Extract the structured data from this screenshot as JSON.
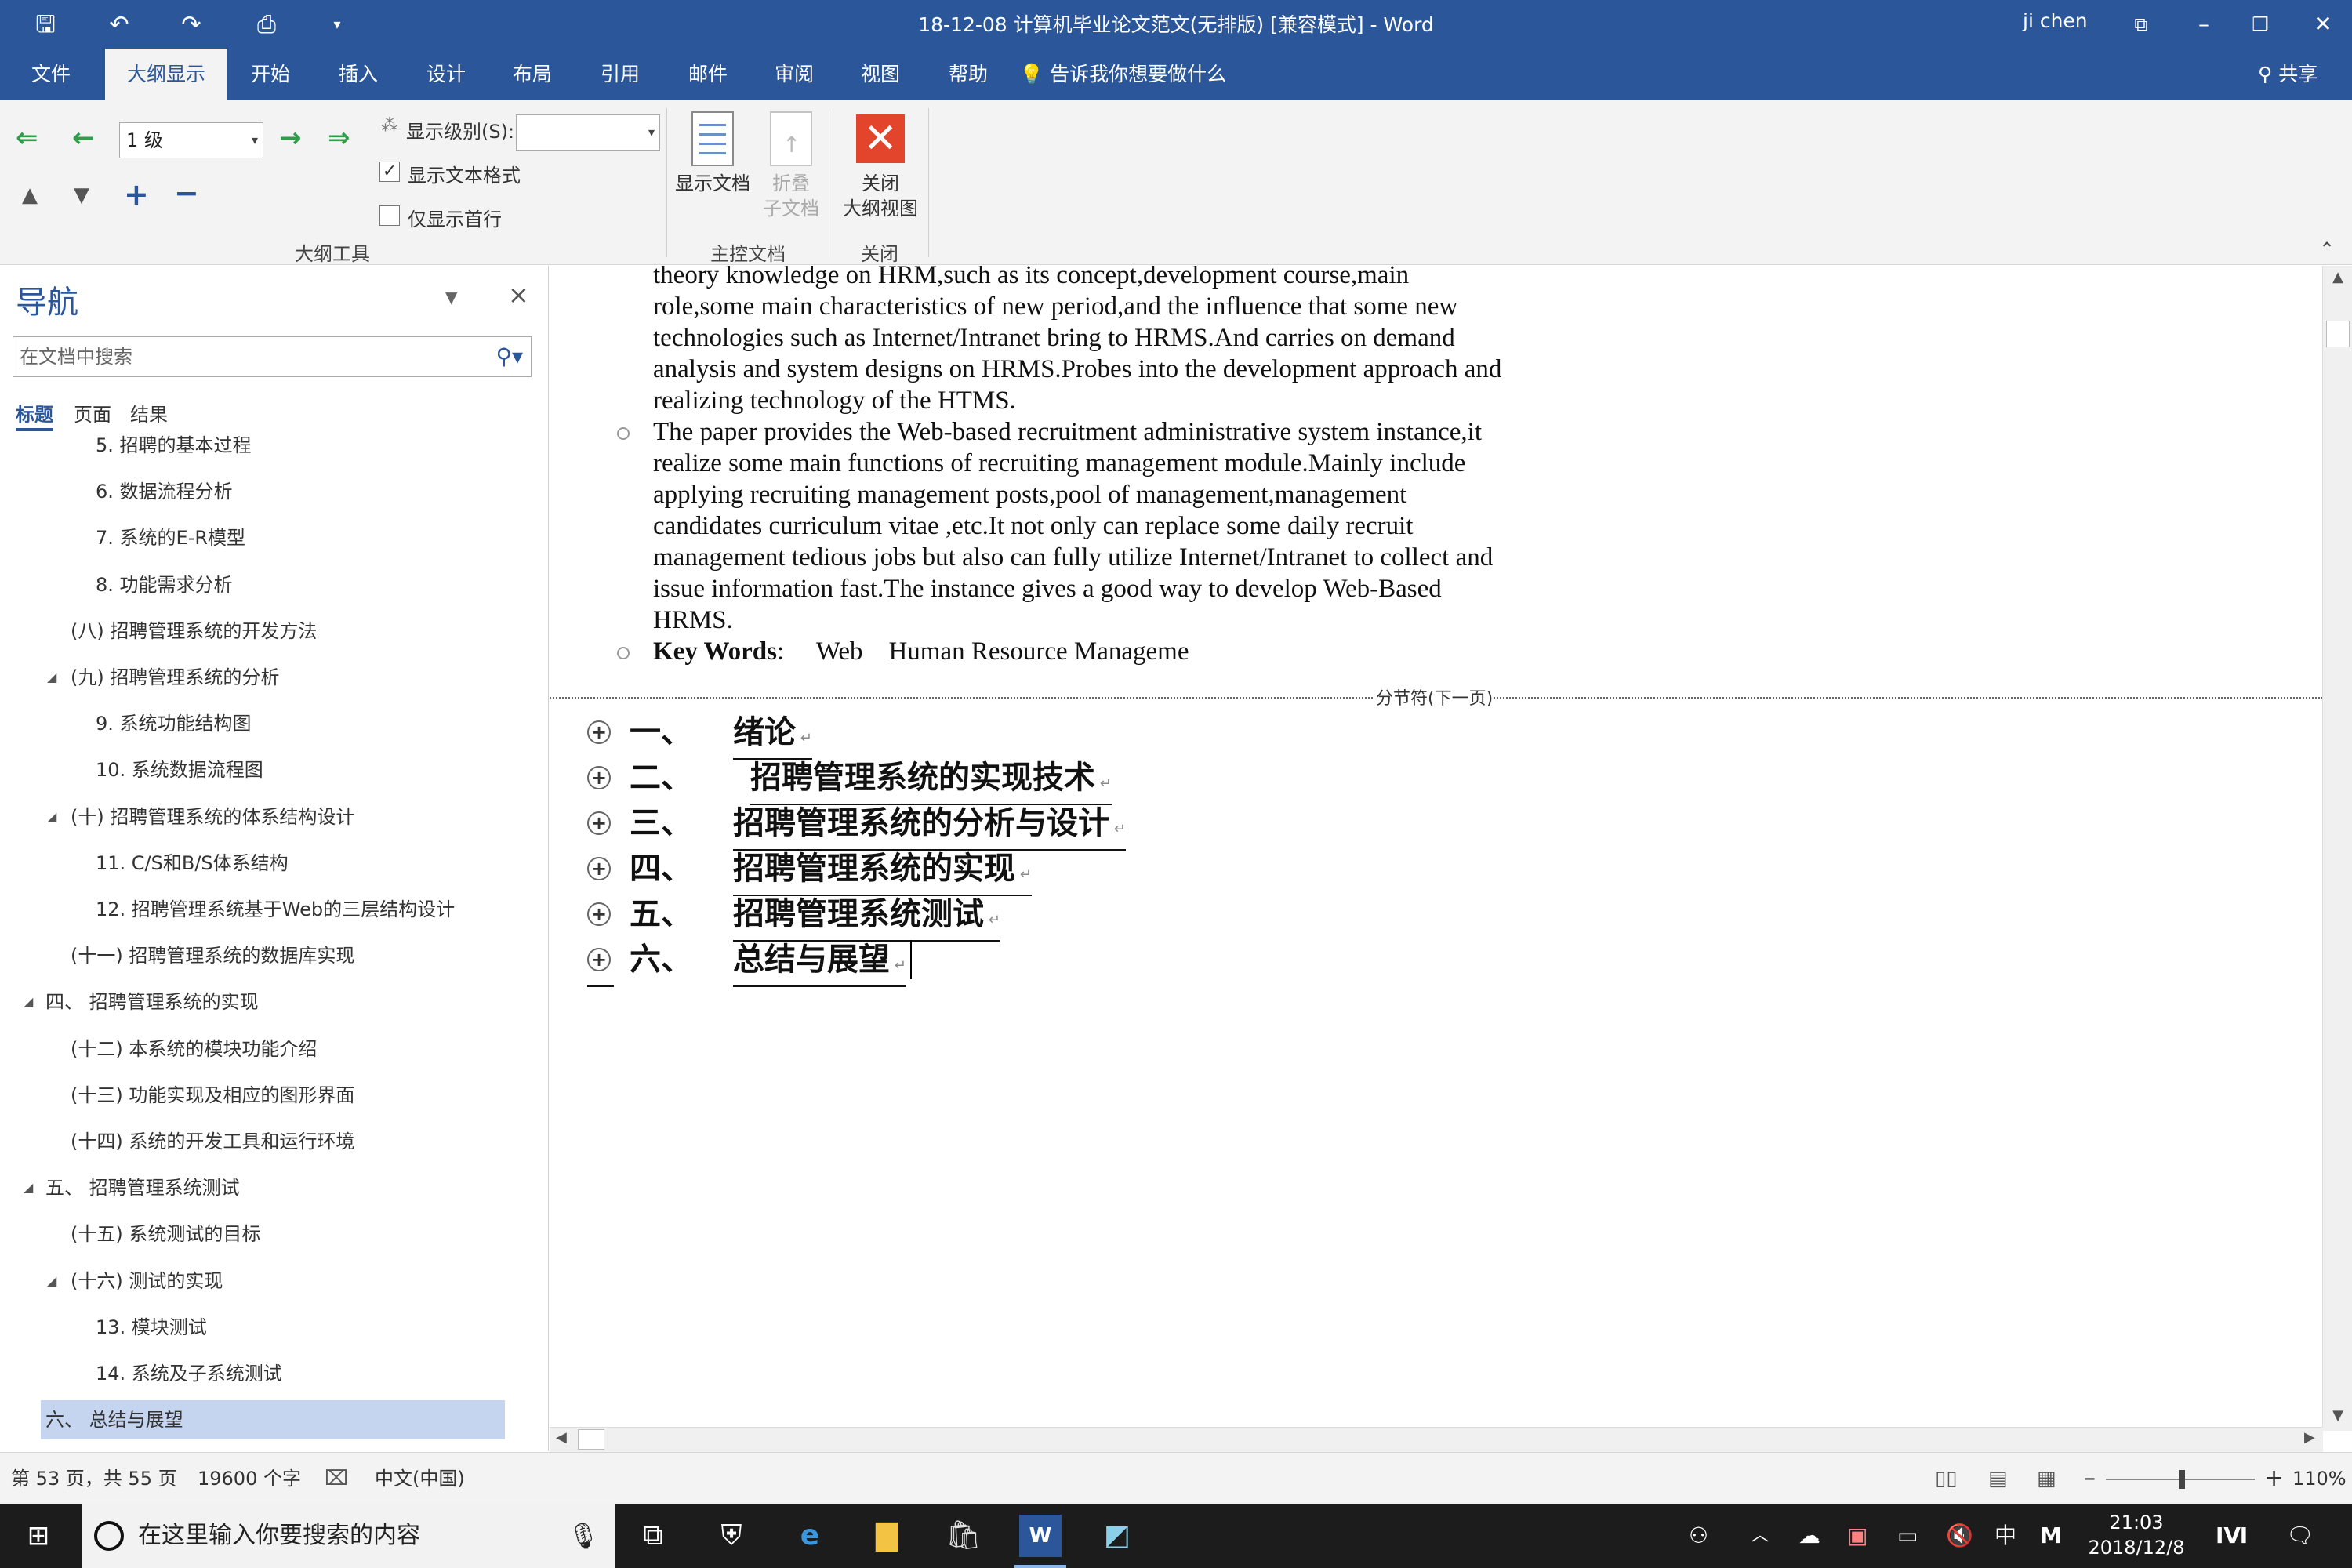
{
  "window": {
    "title": "18-12-08 计算机毕业论文范文(无排版) [兼容模式] - Word",
    "user": "ji chen",
    "qat_icons": [
      "save-icon",
      "undo-icon",
      "redo-icon",
      "print-preview-icon",
      "customize-icon"
    ]
  },
  "tabs": [
    {
      "label": "文件",
      "active": false
    },
    {
      "label": "大纲显示",
      "active": true
    },
    {
      "label": "开始",
      "active": false
    },
    {
      "label": "插入",
      "active": false
    },
    {
      "label": "设计",
      "active": false
    },
    {
      "label": "布局",
      "active": false
    },
    {
      "label": "引用",
      "active": false
    },
    {
      "label": "邮件",
      "active": false
    },
    {
      "label": "审阅",
      "active": false
    },
    {
      "label": "视图",
      "active": false
    },
    {
      "label": "帮助",
      "active": false
    }
  ],
  "tell_me": "告诉我你想要做什么",
  "share": "共享",
  "ribbon": {
    "outline_level": "1 级",
    "show_level_label": "显示级别(S):",
    "show_level_value": "",
    "show_text_format": "显示文本格式",
    "show_text_format_checked": true,
    "first_line_only": "仅显示首行",
    "first_line_only_checked": false,
    "group_outline_tools": "大纲工具",
    "show_document": "显示文档",
    "collapse_subdoc_1": "折叠",
    "collapse_subdoc_2": "子文档",
    "group_master_doc": "主控文档",
    "close_outline_1": "关闭",
    "close_outline_2": "大纲视图",
    "group_close": "关闭"
  },
  "nav": {
    "title": "导航",
    "search_placeholder": "在文档中搜索",
    "tabs": [
      "标题",
      "页面",
      "结果"
    ],
    "items": [
      {
        "text": "5. 招聘的基本过程",
        "level": 3,
        "expander": ""
      },
      {
        "text": "6. 数据流程分析",
        "level": 3,
        "expander": ""
      },
      {
        "text": "7. 系统的E-R模型",
        "level": 3,
        "expander": ""
      },
      {
        "text": "8. 功能需求分析",
        "level": 3,
        "expander": ""
      },
      {
        "text": "(八) 招聘管理系统的开发方法",
        "level": 2,
        "expander": ""
      },
      {
        "text": "(九) 招聘管理系统的分析",
        "level": 2,
        "expander": "◢"
      },
      {
        "text": "9. 系统功能结构图",
        "level": 3,
        "expander": ""
      },
      {
        "text": "10. 系统数据流程图",
        "level": 3,
        "expander": ""
      },
      {
        "text": "(十) 招聘管理系统的体系结构设计",
        "level": 2,
        "expander": "◢"
      },
      {
        "text": "11. C/S和B/S体系结构",
        "level": 3,
        "expander": ""
      },
      {
        "text": "12. 招聘管理系统基于Web的三层结构设计",
        "level": 3,
        "expander": ""
      },
      {
        "text": "(十一) 招聘管理系统的数据库实现",
        "level": 2,
        "expander": ""
      },
      {
        "text": "四、 招聘管理系统的实现",
        "level": 1,
        "expander": "◢"
      },
      {
        "text": "(十二) 本系统的模块功能介绍",
        "level": 2,
        "expander": ""
      },
      {
        "text": "(十三) 功能实现及相应的图形界面",
        "level": 2,
        "expander": ""
      },
      {
        "text": "(十四) 系统的开发工具和运行环境",
        "level": 2,
        "expander": ""
      },
      {
        "text": "五、 招聘管理系统测试",
        "level": 1,
        "expander": "◢"
      },
      {
        "text": "(十五) 系统测试的目标",
        "level": 2,
        "expander": ""
      },
      {
        "text": "(十六) 测试的实现",
        "level": 2,
        "expander": "◢"
      },
      {
        "text": "13. 模块测试",
        "level": 3,
        "expander": ""
      },
      {
        "text": "14. 系统及子系统测试",
        "level": 3,
        "expander": ""
      },
      {
        "text": "六、 总结与展望",
        "level": 1,
        "expander": "",
        "selected": true
      }
    ]
  },
  "document": {
    "para1_lines": [
      "theory knowledge on HRM,such as its concept,development course,main",
      "role,some main characteristics of new period,and the influence that some new",
      "technologies such as Internet/Intranet bring to HRMS.And carries on demand",
      "analysis and system designs on HRMS.Probes into the development approach and",
      "realizing technology of the HTMS."
    ],
    "para2_lines": [
      "The paper provides the Web-based recruitment administrative system instance,it",
      "realize some main functions of recruiting management module.Mainly include",
      "applying recruiting management posts,pool of management,management",
      "candidates curriculum vitae ,etc.It not only can replace some daily recruit",
      "management tedious jobs but also can fully utilize Internet/Intranet to collect and",
      "issue information fast.The instance gives a good way to develop Web-Based",
      "HRMS."
    ],
    "keywords_label": "Key Words",
    "keywords_text": ":     Web    Human Resource Manageme",
    "section_break": "分节符(下一页)",
    "headings": [
      {
        "num": "一、",
        "text": "绪论"
      },
      {
        "num": "二、",
        "text": "招聘管理系统的实现技术"
      },
      {
        "num": "三、",
        "text": "招聘管理系统的分析与设计"
      },
      {
        "num": "四、",
        "text": "招聘管理系统的实现"
      },
      {
        "num": "五、",
        "text": "招聘管理系统测试"
      },
      {
        "num": "六、",
        "text": "总结与展望"
      }
    ]
  },
  "status": {
    "page": "第 53 页，共 55 页",
    "words": "19600 个字",
    "language": "中文(中国)",
    "zoom": "110%",
    "zoom_level": 110
  },
  "taskbar": {
    "search_placeholder": "在这里输入你要搜索的内容",
    "time": "21:03",
    "date": "2018/12/8",
    "ime": "中",
    "ime_mode": "M"
  }
}
